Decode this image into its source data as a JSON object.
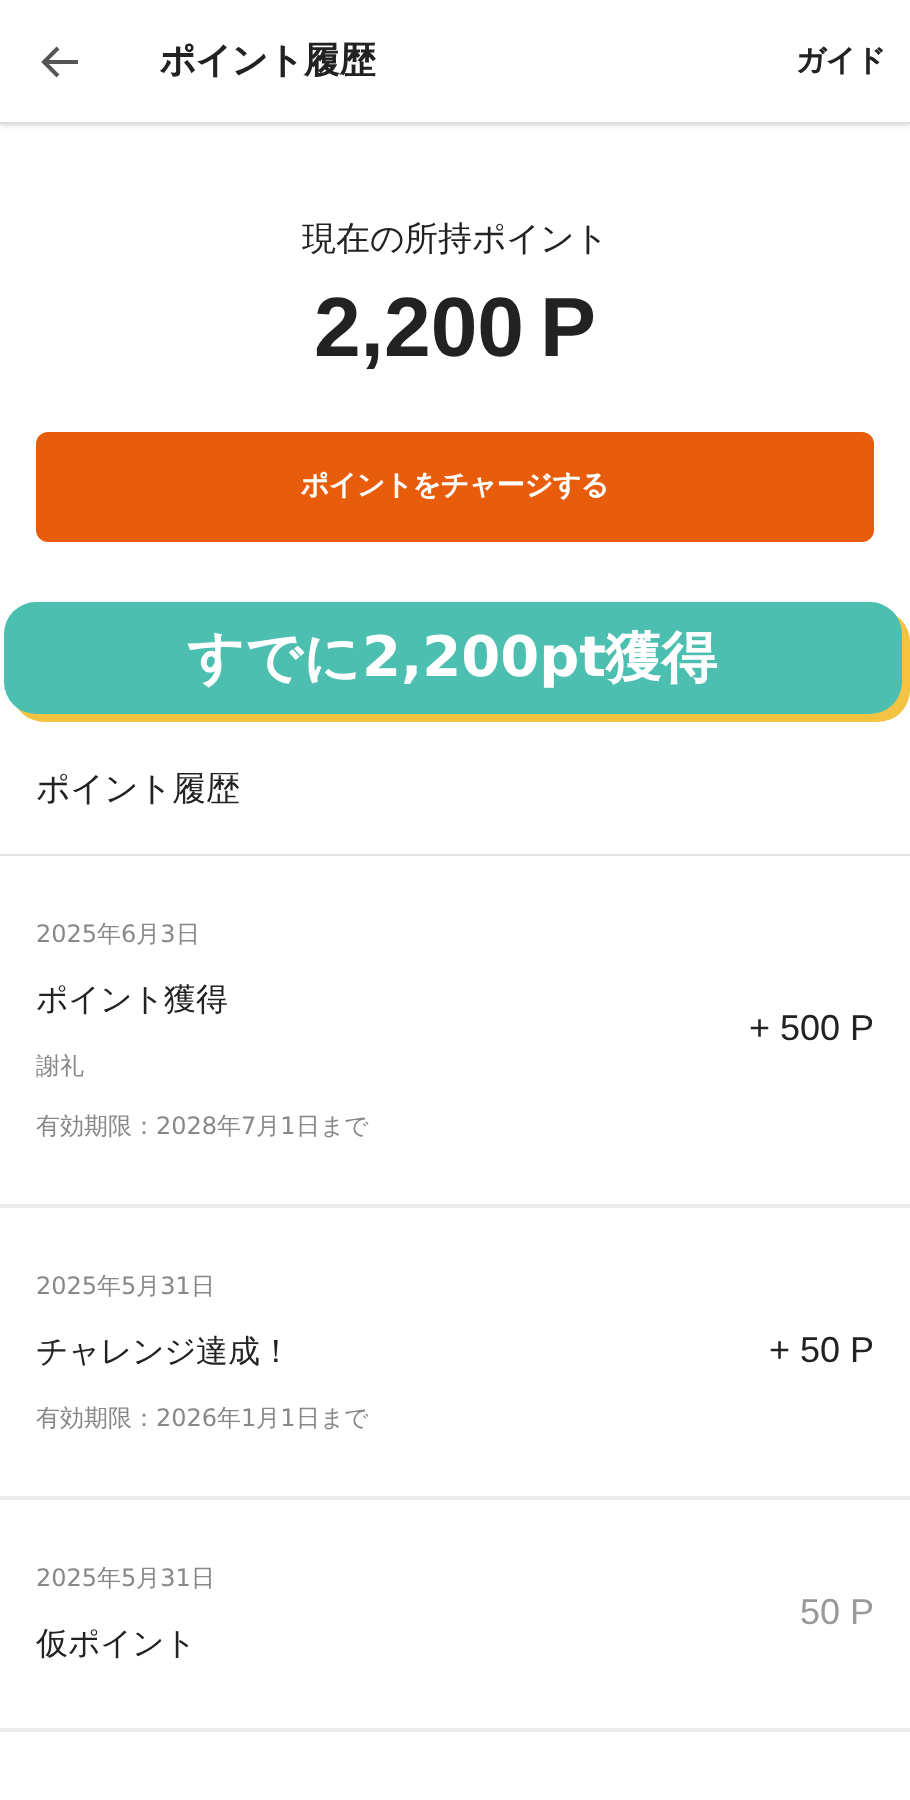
{
  "header": {
    "title": "ポイント履歴",
    "action": "ガイド"
  },
  "balance": {
    "label": "現在の所持ポイント",
    "amount": "2,200",
    "unit": "P"
  },
  "charge_button": "ポイントをチャージする",
  "banner": "すでに2,200pt獲得",
  "section_title": "ポイント履歴",
  "history": [
    {
      "date": "2025年6月3日",
      "title": "ポイント獲得",
      "note": "謝礼",
      "expiry": "有効期限：2028年7月1日まで",
      "amount": "+ 500 P",
      "pending": false
    },
    {
      "date": "2025年5月31日",
      "title": "チャレンジ達成！",
      "expiry": "有効期限：2026年1月1日まで",
      "amount": "+ 50 P",
      "pending": false
    },
    {
      "date": "2025年5月31日",
      "title": "仮ポイント",
      "amount": "50 P",
      "pending": true
    }
  ]
}
